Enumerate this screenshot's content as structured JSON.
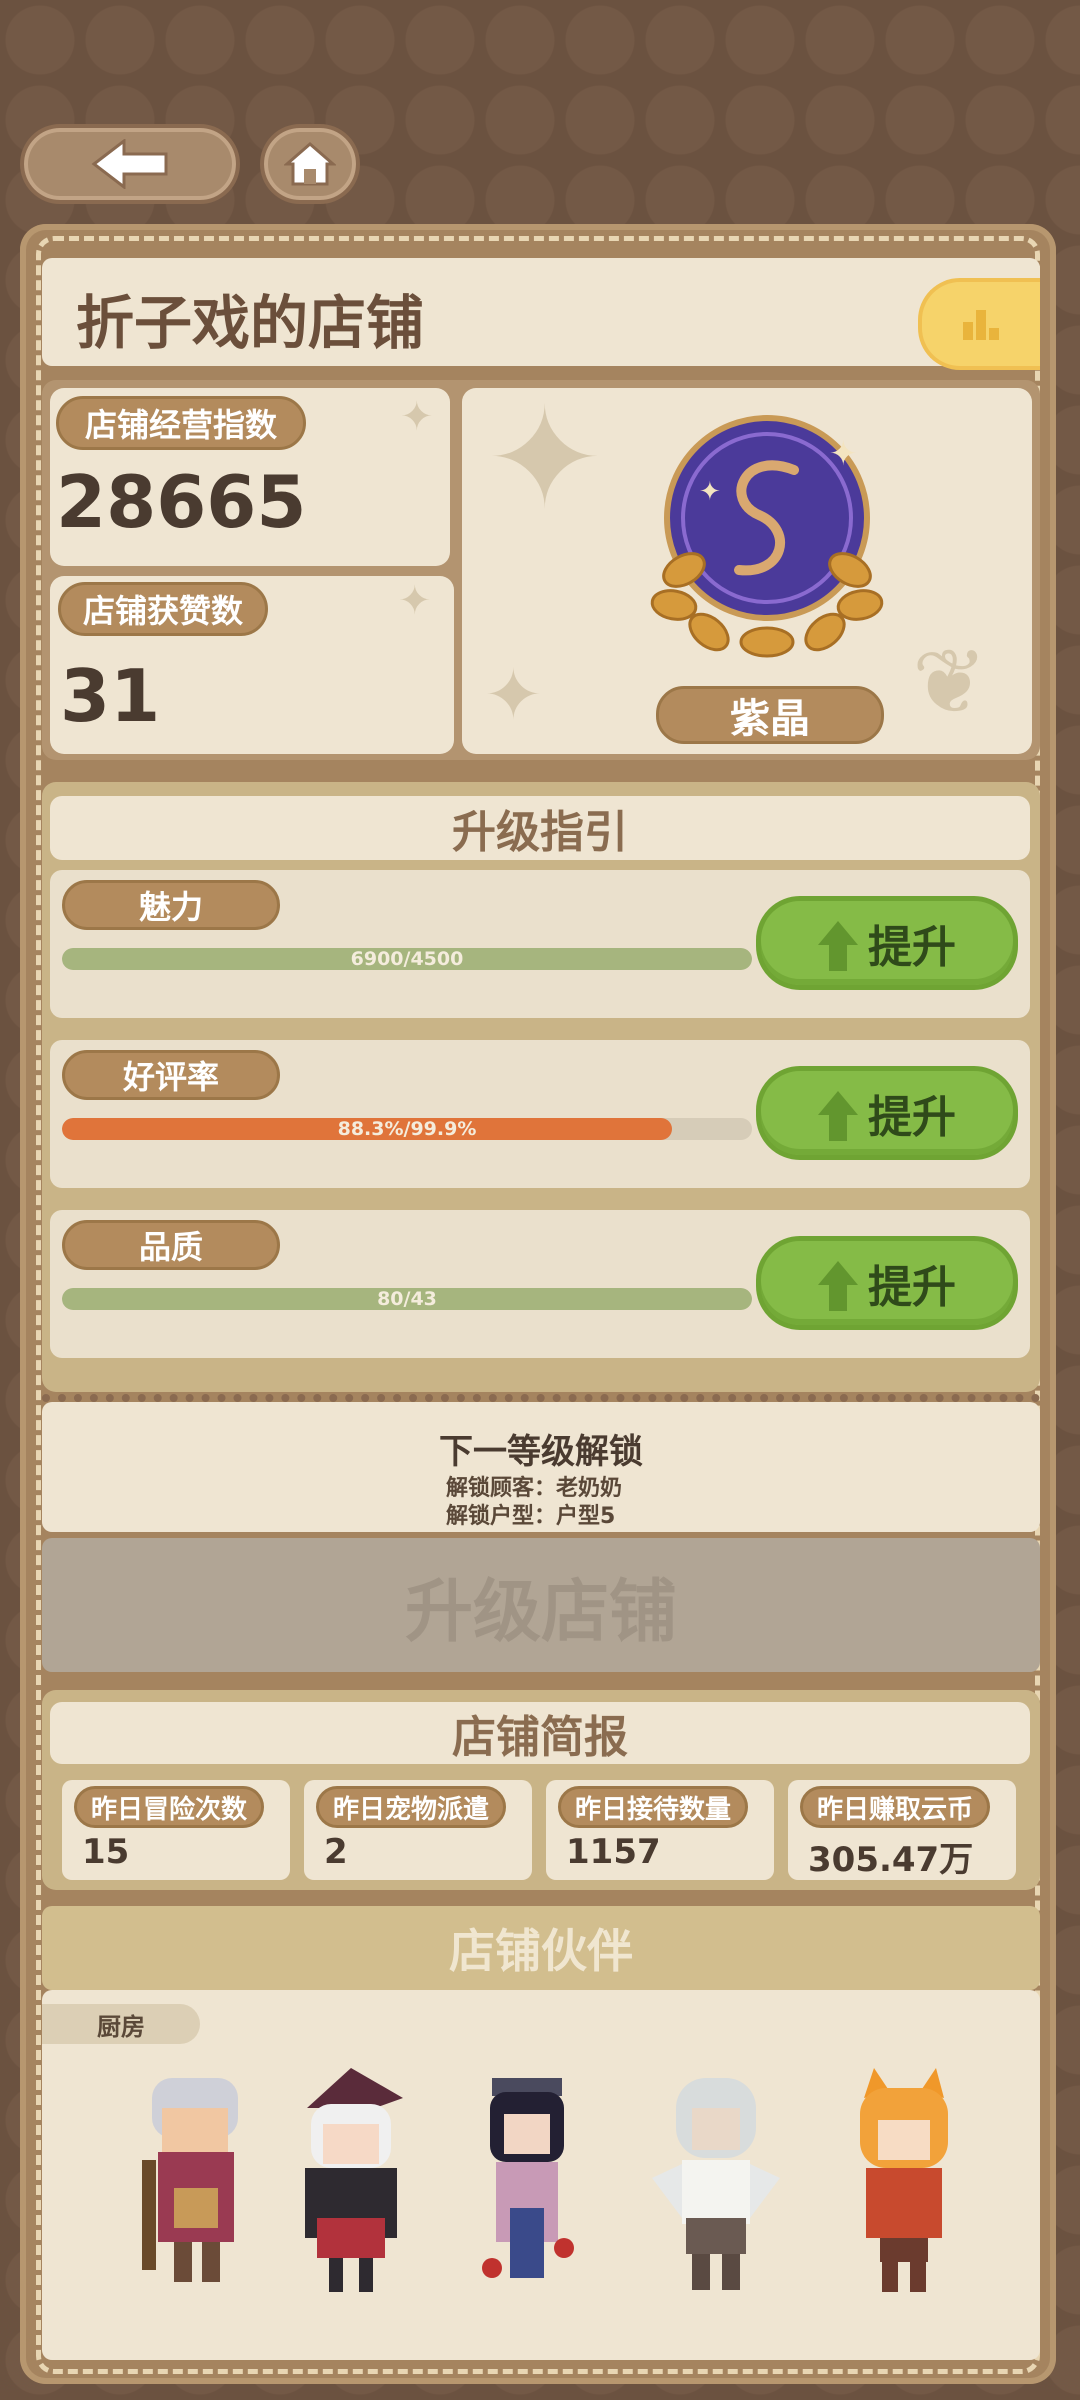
{
  "nav": {
    "back_icon": "back-arrow-icon",
    "home_icon": "home-icon"
  },
  "shop": {
    "title": "折子戏的店铺",
    "rank_icon": "leaderboard-icon"
  },
  "stats": {
    "operation_index_label": "店铺经营指数",
    "operation_index_value": "28665",
    "likes_label": "店铺获赞数",
    "likes_value": "31",
    "badge_name": "紫晶"
  },
  "guide": {
    "title": "升级指引",
    "rows": [
      {
        "label": "魅力",
        "progress_text": "6900/4500",
        "fill": 1.0,
        "color": "#a6b57e",
        "button": "提升"
      },
      {
        "label": "好评率",
        "progress_text": "88.3%/99.9%",
        "fill": 0.884,
        "color": "#e0743a",
        "button": "提升"
      },
      {
        "label": "品质",
        "progress_text": "80/43",
        "fill": 1.0,
        "color": "#a6b57e",
        "button": "提升"
      }
    ]
  },
  "unlock": {
    "title": "下一等级解锁",
    "line1": "解锁顾客：老奶奶",
    "line2": "解锁户型：户型5"
  },
  "upgrade_button": "升级店铺",
  "brief": {
    "title": "店铺简报",
    "items": [
      {
        "label": "昨日冒险次数",
        "value": "15"
      },
      {
        "label": "昨日宠物派遣",
        "value": "2"
      },
      {
        "label": "昨日接待数量",
        "value": "1157"
      },
      {
        "label": "昨日赚取云币",
        "value": "305.47万"
      }
    ]
  },
  "partners": {
    "title": "店铺伙伴",
    "kitchen_label": "厨房"
  }
}
